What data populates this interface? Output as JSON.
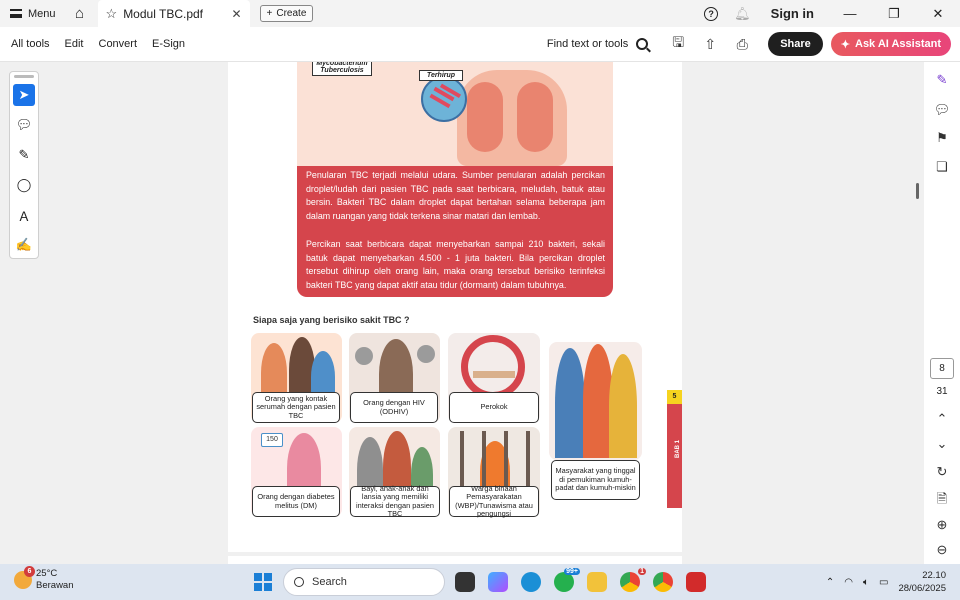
{
  "titlebar": {
    "menu_label": "Menu",
    "tab_title": "Modul TBC.pdf",
    "create_label": "Create",
    "signin_label": "Sign in"
  },
  "toolbar": {
    "items": [
      "All tools",
      "Edit",
      "Convert",
      "E-Sign"
    ],
    "find_label": "Find text or tools",
    "share_label": "Share",
    "ask_ai_label": "Ask AI Assistant"
  },
  "document": {
    "illus_label_1": "Mycobacterium Tuberculosis",
    "illus_label_2": "Terhirup",
    "para1": "Penularan TBC terjadi melalui udara. Sumber penularan adalah percikan droplet/ludah dari pasien TBC pada saat berbicara, meludah, batuk atau bersin. Bakteri TBC dalam droplet dapat bertahan selama beberapa jam dalam ruangan yang tidak terkena sinar matari dan lembab.",
    "para2": "Percikan saat berbicara dapat menyebarkan sampai 210 bakteri, sekali batuk dapat menyebarkan 4.500 - 1 juta bakteri. Bila percikan droplet tersebut dihirup oleh orang lain, maka orang tersebut berisiko terinfeksi bakteri TBC yang dapat aktif atau tidur (dormant) dalam tubuhnya.",
    "question": "Siapa saja yang berisiko sakit TBC ?",
    "cards": [
      "Orang yang kontak serumah dengan pasien TBC",
      "Orang dengan HIV (ODHIV)",
      "Perokok",
      "Masyarakat yang tinggal di pemukiman kumuh-padat dan kumuh-miskin",
      "Orang dengan diabetes melitus (DM)",
      "Bayi, anak-anak dan lansia yang memiliki interaksi dengan pasien TBC",
      "Warga binaan Pemasyarakatan (WBP)/Tunawisma atau pengungsi"
    ],
    "diabetes_reading": "150",
    "page_tab_number": "5",
    "page_tab_label": "BAB 1"
  },
  "navigation": {
    "current_page": "8",
    "total_pages": "31"
  },
  "taskbar": {
    "weather_badge": "6",
    "temperature": "25°C",
    "weather_desc": "Berawan",
    "search_label": "Search",
    "whatsapp_badge": "99+",
    "chrome_badge": "1",
    "time": "22.10",
    "date": "28/06/2025"
  },
  "colors": {
    "accent_red": "#d5454c",
    "active_tool": "#1a73e8",
    "ai_button": "#e8457a"
  }
}
